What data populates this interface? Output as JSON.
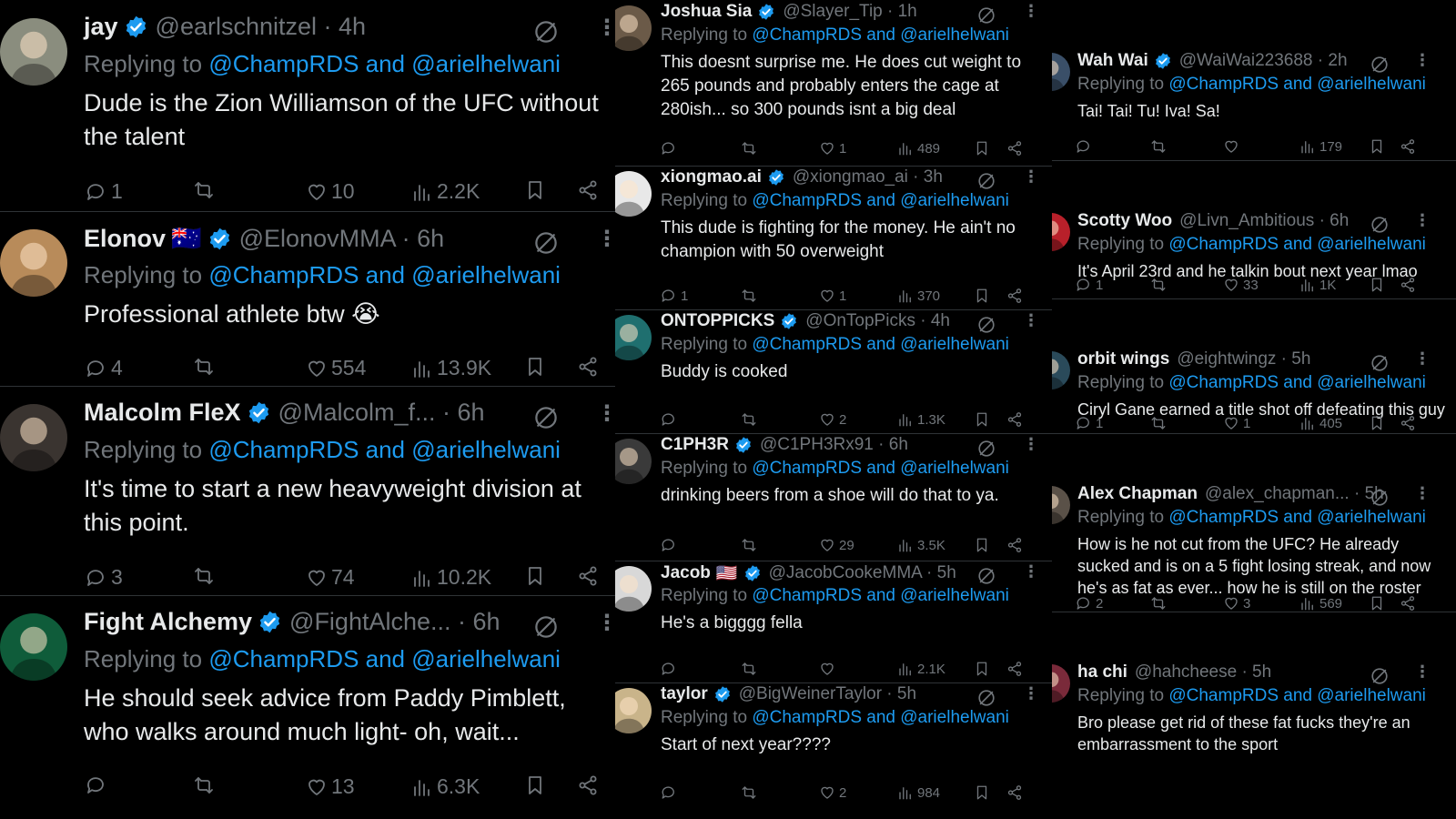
{
  "replying_prefix": "Replying to",
  "replying_mentions": "@ChampRDS and @arielhelwani",
  "colors": {
    "background": "#000000",
    "text": "#e7e9ea",
    "muted": "#71767b",
    "link": "#1d9bf0",
    "verified": "#1d9bf0"
  },
  "icons": [
    "reply-icon",
    "retweet-icon",
    "like-icon",
    "views-icon",
    "bookmark-icon",
    "share-icon",
    "grok-icon",
    "more-icon",
    "verified-icon"
  ],
  "columns": [
    {
      "tweets": [
        {
          "name": "jay",
          "verified": true,
          "flag": "",
          "handle": "@earlschnitzel · 4h",
          "text": "Dude is the Zion Williamson of the UFC without the talent",
          "replies": "1",
          "reposts": "",
          "likes": "10",
          "views": "2.2K"
        },
        {
          "name": "Elonov",
          "verified": true,
          "flag": "🇦🇺",
          "handle": "@ElonovMMA · 6h",
          "text": "Professional athlete btw 😭",
          "replies": "4",
          "reposts": "",
          "likes": "554",
          "views": "13.9K"
        },
        {
          "name": "Malcolm FleX",
          "verified": true,
          "flag": "",
          "handle": "@Malcolm_f... · 6h",
          "text": "It's time to start a new heavyweight division at this point.",
          "replies": "3",
          "reposts": "",
          "likes": "74",
          "views": "10.2K"
        },
        {
          "name": "Fight Alchemy",
          "verified": true,
          "flag": "",
          "handle": "@FightAlche... · 6h",
          "text": "He should seek advice from Paddy Pimblett, who walks around much light- oh, wait...",
          "replies": "",
          "reposts": "",
          "likes": "13",
          "views": "6.3K"
        }
      ]
    },
    {
      "tweets": [
        {
          "name": "Joshua Sia",
          "verified": true,
          "flag": "",
          "handle": "@Slayer_Tip · 1h",
          "text": "This doesnt surprise me. He does cut weight to 265 pounds and probably enters the cage at 280ish... so 300 pounds isnt a big deal",
          "replies": "",
          "reposts": "",
          "likes": "1",
          "views": "489"
        },
        {
          "name": "xiongmao.ai",
          "verified": true,
          "flag": "",
          "handle": "@xiongmao_ai · 3h",
          "text": "This dude is fighting for the money.  He ain't no champion with 50 overweight",
          "replies": "1",
          "reposts": "",
          "likes": "1",
          "views": "370"
        },
        {
          "name": "ONTOPPICKS",
          "verified": true,
          "flag": "",
          "handle": "@OnTopPicks · 4h",
          "text": "Buddy is cooked",
          "replies": "",
          "reposts": "",
          "likes": "2",
          "views": "1.3K"
        },
        {
          "name": "C1PH3R",
          "verified": true,
          "flag": "",
          "handle": "@C1PH3Rx91 · 6h",
          "text": "drinking beers from a shoe will do that to ya.",
          "replies": "",
          "reposts": "",
          "likes": "29",
          "views": "3.5K"
        },
        {
          "name": "Jacob",
          "verified": true,
          "flag": "🇺🇸",
          "handle": "@JacobCookeMMA · 5h",
          "text": "He's a bigggg fella",
          "replies": "",
          "reposts": "",
          "likes": "",
          "views": "2.1K"
        },
        {
          "name": "taylor",
          "verified": true,
          "flag": "",
          "handle": "@BigWeinerTaylor · 5h",
          "text": "Start of next year????",
          "replies": "",
          "reposts": "",
          "likes": "2",
          "views": "984"
        }
      ]
    },
    {
      "tweets": [
        {
          "name": "Wah Wai",
          "verified": true,
          "flag": "",
          "handle": "@WaiWai223688 · 2h",
          "text": "Tai! Tai! Tu! Iva! Sa!",
          "replies": "",
          "reposts": "",
          "likes": "",
          "views": "179"
        },
        {
          "name": "Scotty Woo",
          "verified": false,
          "flag": "",
          "handle": "@Livn_Ambitious · 6h",
          "text": "It's April 23rd and he talkin bout next year lmao",
          "replies": "1",
          "reposts": "",
          "likes": "33",
          "views": "1K"
        },
        {
          "name": "orbit wings",
          "verified": false,
          "flag": "",
          "handle": "@eightwingz · 5h",
          "text": "Ciryl Gane earned a title shot off defeating this guy",
          "replies": "1",
          "reposts": "",
          "likes": "1",
          "views": "405"
        },
        {
          "name": "Alex Chapman",
          "verified": false,
          "flag": "",
          "handle": "@alex_chapman... · 5h",
          "text": "How is he not cut from the UFC? He already sucked and is on a 5 fight losing streak, and now he's as fat as ever... how he is still on the roster",
          "replies": "2",
          "reposts": "",
          "likes": "3",
          "views": "569"
        },
        {
          "name": "ha chi",
          "verified": false,
          "flag": "",
          "handle": "@hahcheese · 5h",
          "text": "Bro please get rid of these fat fucks they're an embarrassment to the sport",
          "replies": "",
          "reposts": "",
          "likes": "",
          "views": ""
        }
      ]
    }
  ]
}
